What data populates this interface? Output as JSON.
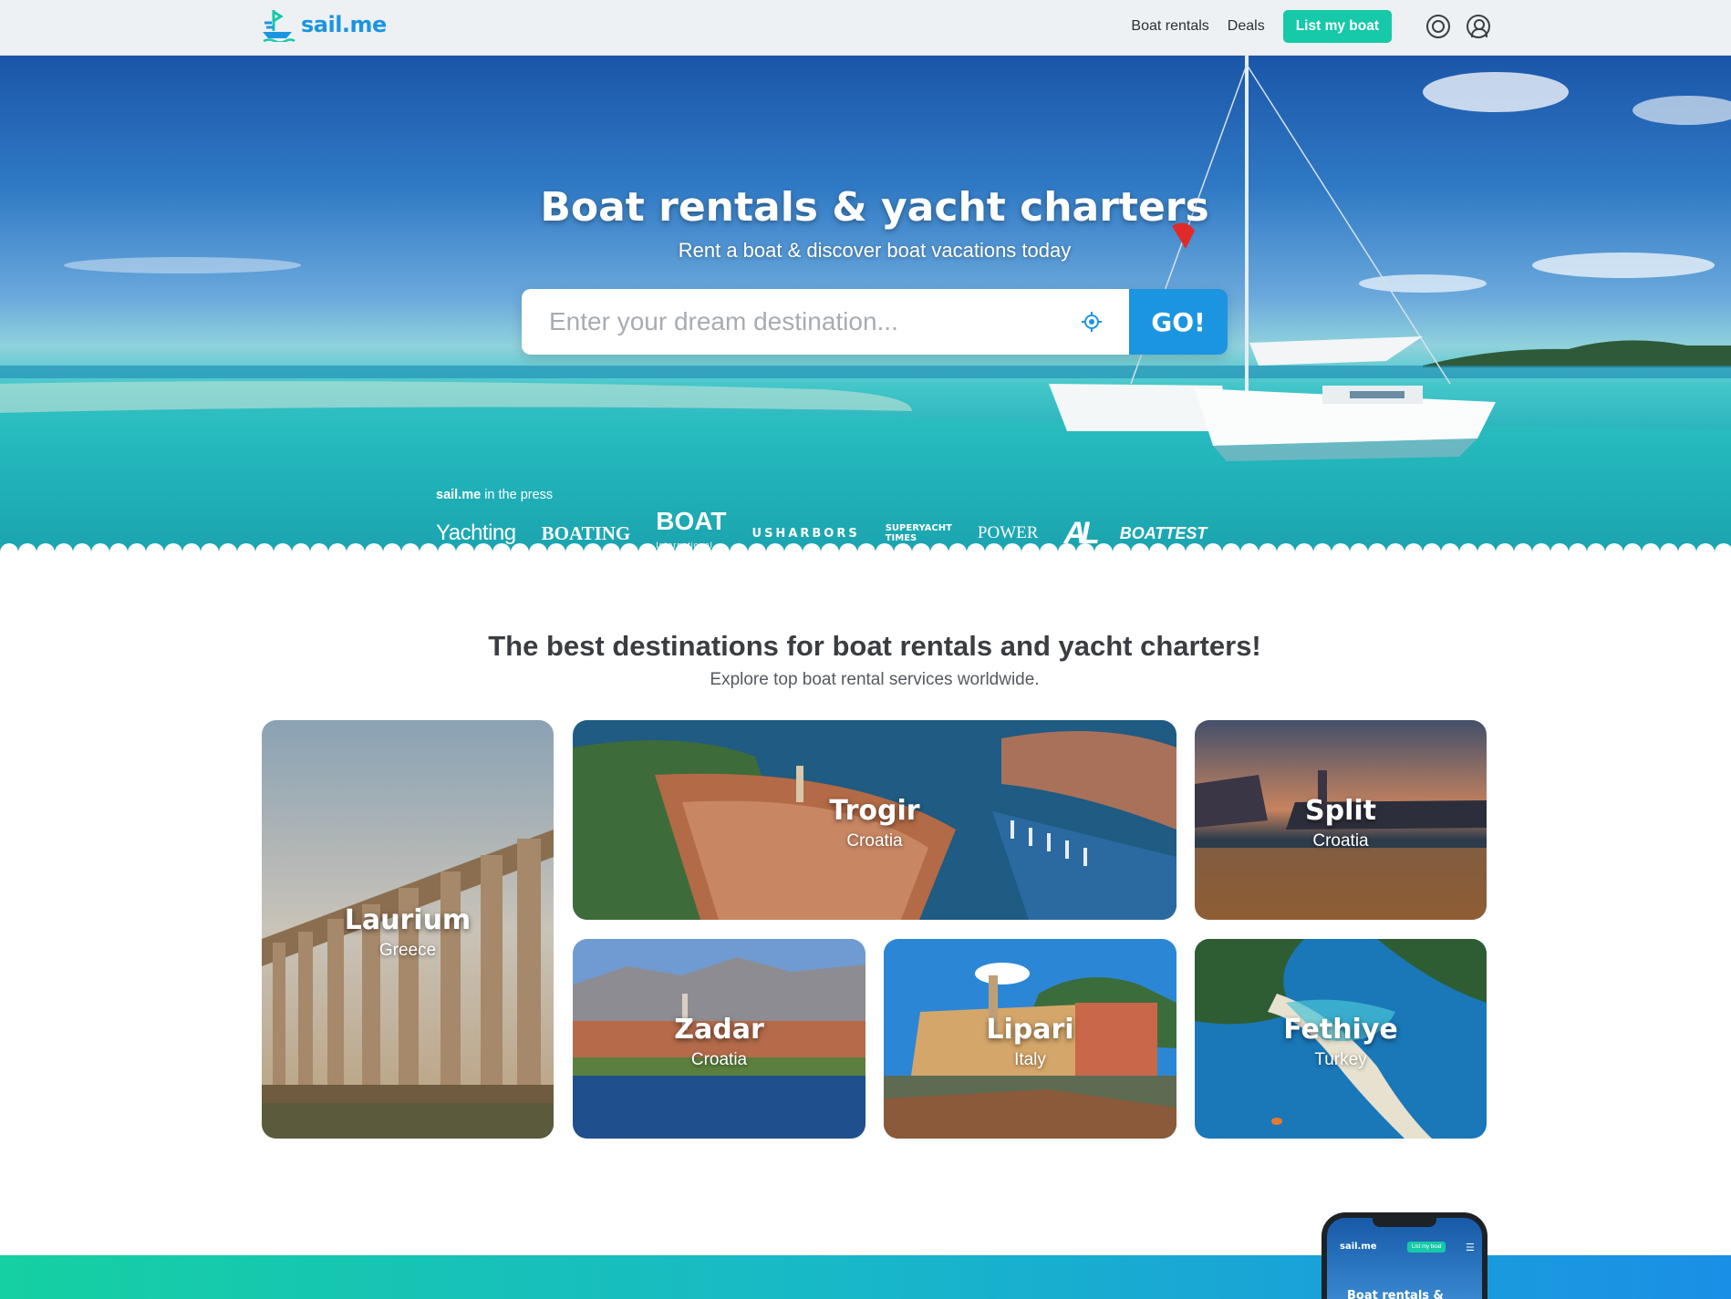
{
  "header": {
    "logo_text": "sail.me",
    "nav": {
      "boat_rentals": "Boat rentals",
      "deals": "Deals",
      "list_my_boat": "List my boat"
    }
  },
  "hero": {
    "title": "Boat rentals & yacht charters",
    "subtitle": "Rent a boat & discover boat vacations today",
    "search_placeholder": "Enter your dream destination...",
    "go_label": "GO!",
    "press_brand": "sail.me",
    "press_suffix": " in the press",
    "press_logos": {
      "yachting": "Yachting",
      "boating": "BOATING",
      "boat": "BOAT",
      "boat_sub": "International",
      "usharbors": "USHARBORS",
      "superyacht_1": "SUPERYACHT",
      "superyacht_2": "TIMES",
      "power": "POWER",
      "al": "AL",
      "boattest": "BOATTEST"
    }
  },
  "destinations": {
    "title": "The best destinations for boat rentals and yacht charters!",
    "subtitle": "Explore top boat rental services worldwide.",
    "cards": [
      {
        "name": "Laurium",
        "country": "Greece"
      },
      {
        "name": "Trogir",
        "country": "Croatia"
      },
      {
        "name": "Split",
        "country": "Croatia"
      },
      {
        "name": "Zadar",
        "country": "Croatia"
      },
      {
        "name": "Lipari",
        "country": "Italy"
      },
      {
        "name": "Fethiye",
        "country": "Turkey"
      }
    ]
  },
  "phone_preview": {
    "logo": "sail.me",
    "button": "List my boat",
    "title": "Boat rentals &"
  },
  "colors": {
    "brand_blue": "#1c95e0",
    "accent_teal": "#16c9a8"
  },
  "icons": [
    "logo-boat-icon",
    "help-icon",
    "user-icon",
    "locate-icon",
    "menu-icon"
  ]
}
